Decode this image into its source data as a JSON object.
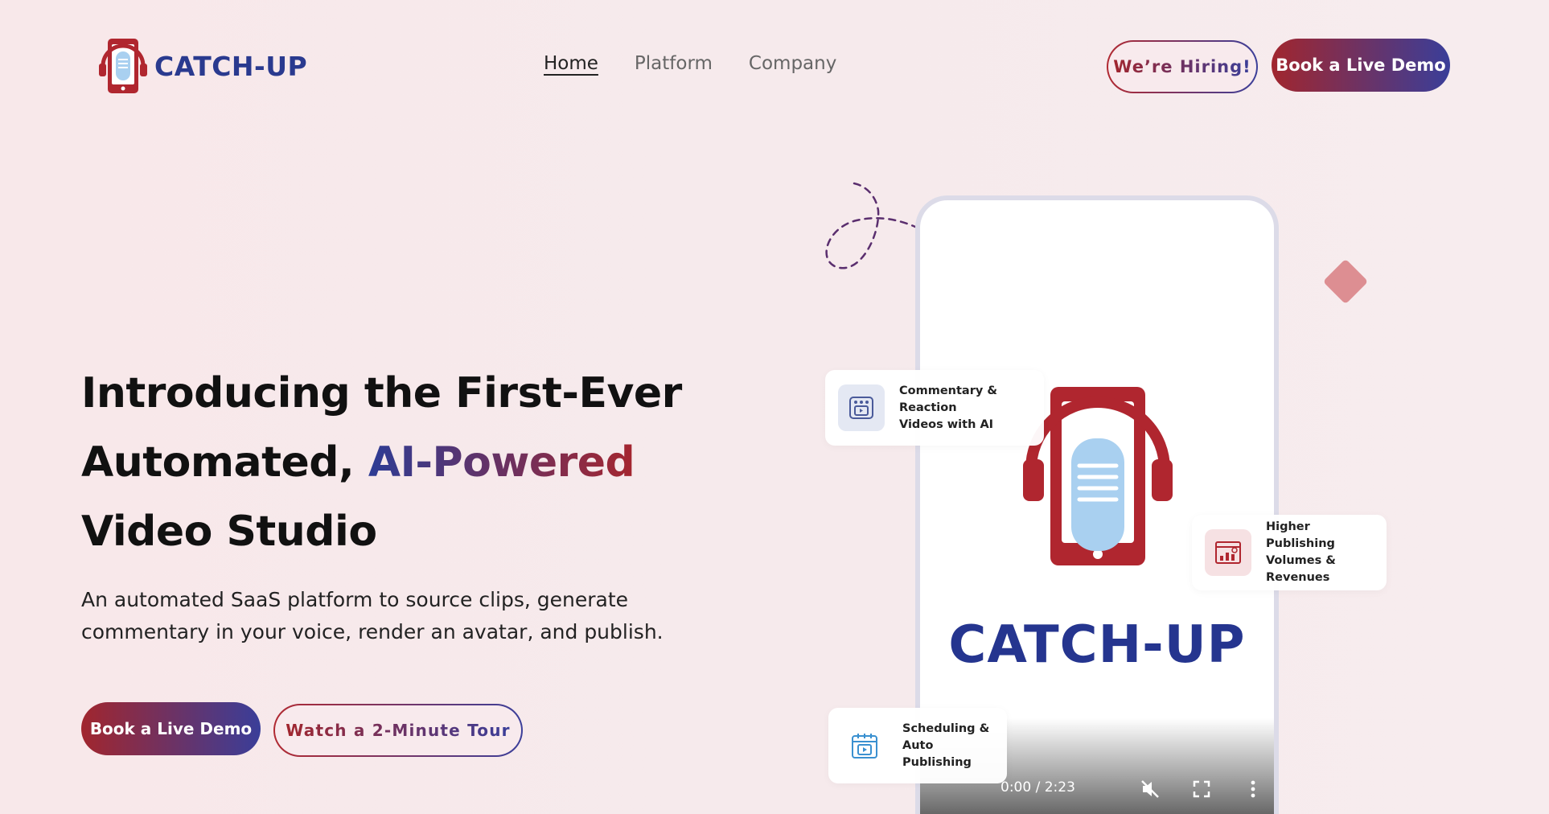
{
  "brand": {
    "name": "CATCH-UP"
  },
  "nav": {
    "items": [
      {
        "label": "Home",
        "active": true
      },
      {
        "label": "Platform",
        "active": false
      },
      {
        "label": "Company",
        "active": false
      }
    ]
  },
  "header": {
    "hiring_label": "We’re Hiring!",
    "book_demo_label": "Book a Live Demo"
  },
  "hero": {
    "headline_line1": "Introducing the First-Ever",
    "headline_line2_plain": "Automated, ",
    "headline_line2_accent": "AI-Powered",
    "headline_line3": "Video Studio",
    "subtext": "An automated SaaS platform to source clips, generate commentary in your voice, render an avatar, and publish.",
    "primary_cta": "Book a Live Demo",
    "secondary_cta": "Watch a 2-Minute Tour"
  },
  "video": {
    "brand_text": "CATCH-UP",
    "time": "0:00 / 2:23",
    "icons": [
      "mute-icon",
      "fullscreen-icon",
      "more-options-icon"
    ]
  },
  "features": [
    {
      "label_line1": "Commentary & Reaction",
      "label_line2": "Videos with AI",
      "icon": "video-editor-icon"
    },
    {
      "label_line1": "Higher Publishing",
      "label_line2": "Volumes & Revenues",
      "icon": "revenue-chart-icon"
    },
    {
      "label_line1": "Scheduling &",
      "label_line2": "Auto Publishing",
      "icon": "calendar-video-icon"
    }
  ],
  "colors": {
    "brand_blue": "#2a3a8f",
    "brand_red": "#a1262e",
    "background": "#f7eaec",
    "diamond": "#dd8e92"
  }
}
